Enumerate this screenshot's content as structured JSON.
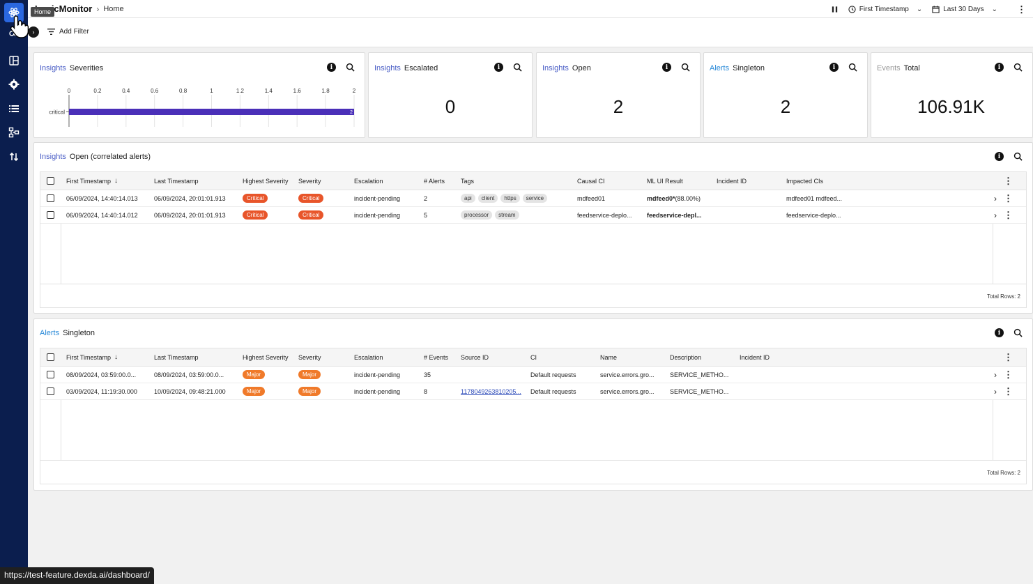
{
  "header": {
    "brand": "LogicMonitor",
    "breadcrumb": "Home",
    "time_field": "First Timestamp",
    "date_range": "Last 30 Days"
  },
  "sidebar": {
    "tooltip": "Home",
    "items": [
      {
        "icon": "atom-icon",
        "active": true
      },
      {
        "icon": "settings-cluster-icon"
      },
      {
        "icon": "dashboard-icon"
      },
      {
        "icon": "gear-icon"
      },
      {
        "icon": "list-icon"
      },
      {
        "icon": "topology-icon"
      },
      {
        "icon": "sort-icon"
      }
    ]
  },
  "filter": {
    "add_label": "Add Filter"
  },
  "widgets": {
    "severities": {
      "kw": "Insights",
      "title": "Severities",
      "chart_data": {
        "type": "bar",
        "orientation": "horizontal",
        "categories": [
          "critical"
        ],
        "values": [
          2
        ],
        "xlim": [
          0,
          2
        ],
        "xticks": [
          "0",
          "0.2",
          "0.4",
          "0.6",
          "0.8",
          "1",
          "1.2",
          "1.4",
          "1.6",
          "1.8",
          "2"
        ],
        "data_labels": [
          "2"
        ],
        "color": "#4a2fb8"
      }
    },
    "escalated": {
      "kw": "Insights",
      "title": "Escalated",
      "value": "0"
    },
    "open": {
      "kw": "Insights",
      "title": "Open",
      "value": "2"
    },
    "singleton": {
      "kw": "Alerts",
      "title": "Singleton",
      "value": "2"
    },
    "events": {
      "kw": "Events",
      "title": "Total",
      "value": "106.91K"
    }
  },
  "insights_table": {
    "kw": "Insights",
    "title": "Open (correlated alerts)",
    "columns": [
      "First Timestamp",
      "Last Timestamp",
      "Highest Severity",
      "Severity",
      "Escalation",
      "# Alerts",
      "Tags",
      "Causal CI",
      "ML UI Result",
      "Incident ID",
      "Impacted CIs"
    ],
    "rows": [
      {
        "first": "06/09/2024, 14:40:14.013",
        "last": "06/09/2024, 20:01:01.913",
        "highest": "Critical",
        "severity": "Critical",
        "escalation": "incident-pending",
        "count": "2",
        "tags": [
          "api",
          "client",
          "https",
          "service"
        ],
        "causal": "mdfeed01",
        "ml_bold": "mdfeed0*",
        "ml_rest": " (88.00%)",
        "incident": "",
        "impacted": "mdfeed01 mdfeed..."
      },
      {
        "first": "06/09/2024, 14:40:14.012",
        "last": "06/09/2024, 20:01:01.913",
        "highest": "Critical",
        "severity": "Critical",
        "escalation": "incident-pending",
        "count": "5",
        "tags": [
          "processor",
          "stream"
        ],
        "causal": "feedservice-deplo...",
        "ml_bold": "feedservice-depl...",
        "ml_rest": "",
        "incident": "",
        "impacted": "feedservice-deplo..."
      }
    ],
    "footer": "Total Rows: 2"
  },
  "alerts_table": {
    "kw": "Alerts",
    "title": "Singleton",
    "columns": [
      "First Timestamp",
      "Last Timestamp",
      "Highest Severity",
      "Severity",
      "Escalation",
      "# Events",
      "Source ID",
      "CI",
      "Name",
      "Description",
      "Incident ID"
    ],
    "rows": [
      {
        "first": "08/09/2024, 03:59:00.0...",
        "last": "08/09/2024, 03:59:00.0...",
        "highest": "Major",
        "severity": "Major",
        "escalation": "incident-pending",
        "count": "35",
        "source": "",
        "ci": "Default requests",
        "name": "service.errors.gro...",
        "desc": "SERVICE_METHO...",
        "incident": ""
      },
      {
        "first": "03/09/2024, 11:19:30.000",
        "last": "10/09/2024, 09:48:21.000",
        "highest": "Major",
        "severity": "Major",
        "escalation": "incident-pending",
        "count": "8",
        "source": "1178049263810205...",
        "ci": "Default requests",
        "name": "service.errors.gro...",
        "desc": "SERVICE_METHO...",
        "incident": ""
      }
    ],
    "footer": "Total Rows: 2"
  },
  "statusbar": {
    "url": "https://test-feature.dexda.ai/dashboard/"
  }
}
